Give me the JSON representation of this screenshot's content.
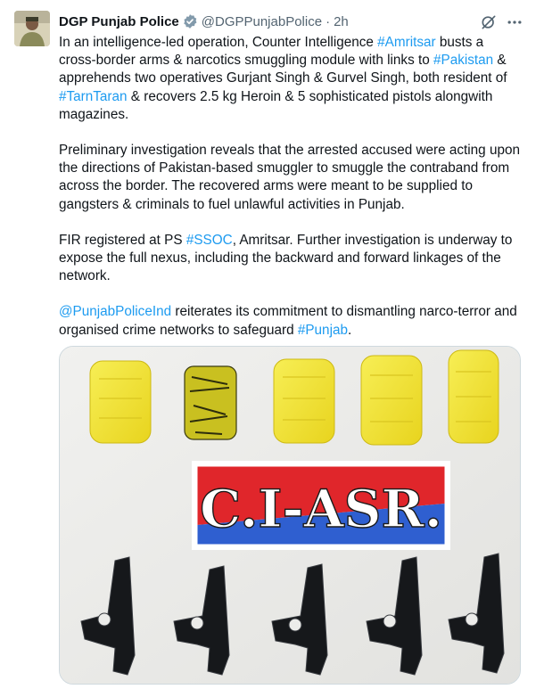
{
  "author": {
    "name": "DGP Punjab Police",
    "handle": "@DGPPunjabPolice",
    "separator": "·",
    "time": "2h",
    "verified_icon": "verified-badge-icon"
  },
  "actions": {
    "grok_icon": "grok-icon",
    "more_icon": "more-icon"
  },
  "tweet": {
    "p1": {
      "t1": "In an intelligence-led operation, Counter Intelligence ",
      "h1": "#Amritsar",
      "t2": " busts a cross-border arms & narcotics smuggling module with links to ",
      "h2": "#Pakistan",
      "t3": " & apprehends two operatives Gurjant Singh & Gurvel Singh, both resident of ",
      "h3": "#TarnTaran",
      "t4": " & recovers 2.5 kg Heroin & 5 sophisticated pistols alongwith magazines."
    },
    "p2": "Preliminary investigation reveals that the arrested accused were acting upon the directions of Pakistan-based smuggler to smuggle the contraband from across the border. The recovered arms were meant to be supplied to gangsters & criminals to fuel unlawful activities in Punjab.",
    "p3": {
      "t1": "FIR registered at PS ",
      "h1": "#SSOC",
      "t2": ", Amritsar. Further investigation is underway to expose the full nexus, including the backward and forward linkages of the network."
    },
    "p4": {
      "m1": "@PunjabPoliceInd",
      "t1": " reiterates its commitment to dismantling narco-terror and organised crime networks to safeguard ",
      "h1": "#Punjab",
      "t2": "."
    }
  },
  "media": {
    "sign_text": "C.I-ASR.",
    "packet_count": 5,
    "pistol_count": 5
  },
  "colors": {
    "link": "#1d9bf0",
    "muted": "#536471",
    "sign_red": "#e0262b",
    "sign_blue": "#2f5fd0",
    "packet_yellow": "#f2e43a"
  }
}
